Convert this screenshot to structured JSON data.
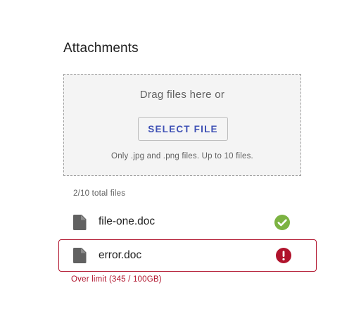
{
  "attachments": {
    "title": "Attachments",
    "dropzone": {
      "prompt": "Drag files here or",
      "select_button_label": "SELECT FILE",
      "hint": "Only .jpg and .png files. Up to 10 files."
    },
    "file_count": "2/10 total files",
    "files": [
      {
        "name": "file-one.doc",
        "icon": "file-icon",
        "status": "success",
        "status_icon": "check-circle-icon",
        "status_color": "#7cb342"
      },
      {
        "name": "error.doc",
        "icon": "file-icon",
        "status": "error",
        "status_icon": "error-icon",
        "status_color": "#b0132c",
        "error_message": "Over limit (345 / 100GB)"
      }
    ]
  },
  "colors": {
    "accent": "#3f51b5",
    "error": "#b0132c",
    "success": "#7cb342",
    "dropzone_bg": "#f4f4f4"
  }
}
